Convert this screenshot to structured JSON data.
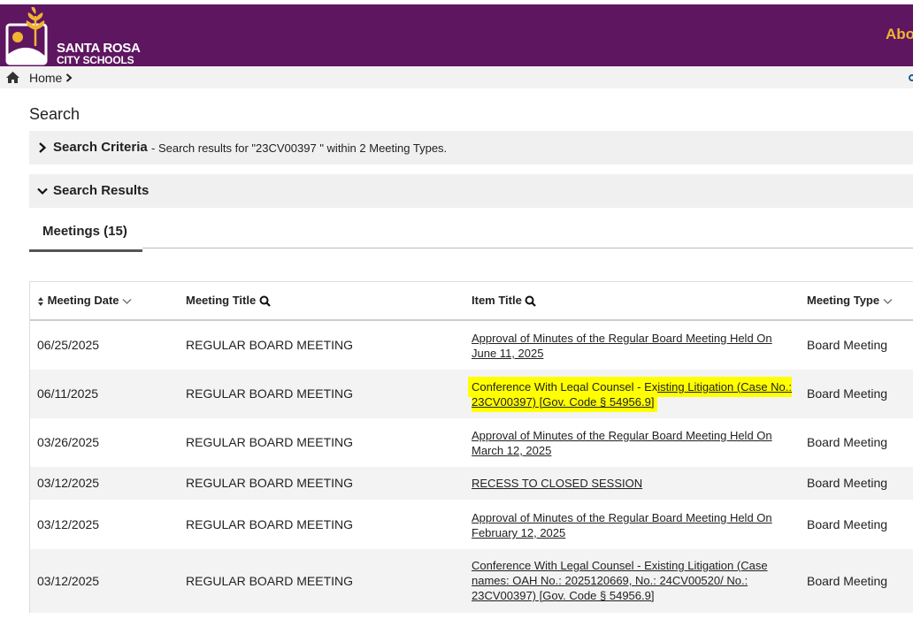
{
  "header": {
    "brand_line1": "SANTA ROSA",
    "brand_line2": "CITY SCHOOLS",
    "nav_about": "Abo"
  },
  "breadcrumb": {
    "home": "Home"
  },
  "page_title": "Search",
  "search_criteria": {
    "title": "Search Criteria",
    "description": "- Search results for \"23CV00397 \" within 2 Meeting Types."
  },
  "search_results": {
    "title": "Search Results"
  },
  "tabs": [
    {
      "label": "Meetings (15)"
    }
  ],
  "table": {
    "columns": [
      "Meeting Date",
      "Meeting Title",
      "Item Title",
      "Meeting Type"
    ],
    "rows": [
      {
        "date": "06/25/2025",
        "title": "REGULAR BOARD MEETING",
        "item": "Approval of Minutes of the Regular Board Meeting Held On June 11, 2025",
        "type": "Board Meeting",
        "highlight": false
      },
      {
        "date": "06/11/2025",
        "title": "REGULAR BOARD MEETING",
        "item": "Conference With Legal Counsel - Existing Litigation (Case No.: 23CV00397) [Gov. Code § 54956.9]",
        "type": "Board Meeting",
        "highlight": true
      },
      {
        "date": "03/26/2025",
        "title": "REGULAR BOARD MEETING",
        "item": "Approval of Minutes of the Regular Board Meeting Held On March 12, 2025",
        "type": "Board Meeting",
        "highlight": false
      },
      {
        "date": "03/12/2025",
        "title": "REGULAR BOARD MEETING",
        "item": "RECESS TO CLOSED SESSION",
        "type": "Board Meeting",
        "highlight": false
      },
      {
        "date": "03/12/2025",
        "title": "REGULAR BOARD MEETING",
        "item": "Approval of Minutes of the Regular Board Meeting Held On February 12, 2025",
        "type": "Board Meeting",
        "highlight": false
      },
      {
        "date": "03/12/2025",
        "title": "REGULAR BOARD MEETING",
        "item": "Conference With Legal Counsel - Existing Litigation (Case names: OAH No.: 2025120669, No.: 24CV00520/ No.: 23CV00397) [Gov. Code § 54956.9]",
        "type": "Board Meeting",
        "highlight": false
      }
    ]
  },
  "colors": {
    "brand": "#5e1660",
    "accent": "#f0b431",
    "highlight": "#ffff00"
  }
}
